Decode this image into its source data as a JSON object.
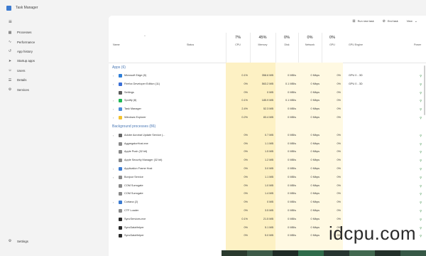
{
  "window": {
    "title": "Task Manager"
  },
  "nav": {
    "items": [
      {
        "label": "Processes",
        "icon": "grid-icon",
        "glyph": "▦"
      },
      {
        "label": "Performance",
        "icon": "chart-icon",
        "glyph": "∿"
      },
      {
        "label": "App history",
        "icon": "history-icon",
        "glyph": "↺"
      },
      {
        "label": "Startup apps",
        "icon": "startup-icon",
        "glyph": "➤"
      },
      {
        "label": "Users",
        "icon": "users-icon",
        "glyph": "☺"
      },
      {
        "label": "Details",
        "icon": "details-icon",
        "glyph": "☰"
      },
      {
        "label": "Services",
        "icon": "services-icon",
        "glyph": "⚙"
      }
    ],
    "settings": {
      "label": "Settings",
      "glyph": "⚙"
    }
  },
  "toolbar": {
    "run_task": "Run new task",
    "end_task": "End task",
    "view": "View"
  },
  "columns": {
    "name": "Name",
    "status": "Status",
    "cpu": {
      "pct": "7%",
      "label": "CPU"
    },
    "memory": {
      "pct": "45%",
      "label": "Memory"
    },
    "disk": {
      "pct": "0%",
      "label": "Disk"
    },
    "network": {
      "pct": "0%",
      "label": "Network"
    },
    "gpu": {
      "pct": "0%",
      "label": "GPU"
    },
    "gpu_engine": {
      "label": "GPU Engine"
    },
    "power": {
      "label": "Power"
    }
  },
  "colors": {
    "heat_light": "#fff9e2",
    "heat_mid": "#fdf1c4",
    "section_blue": "#4a78b5"
  },
  "apps": {
    "title": "Apps (6)",
    "rows": [
      {
        "name": "Microsoft Edge (8)",
        "color": "#2f7fd8",
        "cpu": "0.1%",
        "mem": "358.6 MB",
        "disk": "0 MB/s",
        "net": "0 Mbps",
        "gpu": "0%",
        "engine": "GPU 0 - 3D"
      },
      {
        "name": "Firefox Developer Edition (11)",
        "color": "#3a6fd6",
        "cpu": "0%",
        "mem": "563.2 MB",
        "disk": "0.1 MB/s",
        "net": "0 Mbps",
        "gpu": "0%",
        "engine": "GPU 0 - 3D"
      },
      {
        "name": "Settings",
        "color": "#5b5b5b",
        "cpu": "0%",
        "mem": "0 MB",
        "disk": "0 MB/s",
        "net": "0 Mbps",
        "gpu": "0%",
        "engine": ""
      },
      {
        "name": "Spotify (8)",
        "color": "#1db954",
        "cpu": "0.1%",
        "mem": "185.9 MB",
        "disk": "0.1 MB/s",
        "net": "0 Mbps",
        "gpu": "0%",
        "engine": ""
      },
      {
        "name": "Task Manager",
        "color": "#4c8bd8",
        "cpu": "2.4%",
        "mem": "52.3 MB",
        "disk": "0 MB/s",
        "net": "0 Mbps",
        "gpu": "0%",
        "engine": ""
      },
      {
        "name": "Windows Explorer",
        "color": "#f2c230",
        "cpu": "0.2%",
        "mem": "83.4 MB",
        "disk": "0 MB/s",
        "net": "0 Mbps",
        "gpu": "0%",
        "engine": ""
      }
    ]
  },
  "background": {
    "title": "Background processes (86)",
    "rows": [
      {
        "name": "Adobe Acrobat Update Service (...",
        "color": "#666666",
        "cpu": "0%",
        "mem": "0.7 MB",
        "disk": "0 MB/s",
        "net": "0 Mbps",
        "gpu": "0%"
      },
      {
        "name": "AggregatorHost.exe",
        "color": "#8a8a8a",
        "cpu": "0%",
        "mem": "1.1 MB",
        "disk": "0 MB/s",
        "net": "0 Mbps",
        "gpu": "0%"
      },
      {
        "name": "Apple Push (32 bit)",
        "color": "#8a8a8a",
        "cpu": "0%",
        "mem": "1.5 MB",
        "disk": "0 MB/s",
        "net": "0 Mbps",
        "gpu": "0%"
      },
      {
        "name": "Apple Security Manager (32 bit)",
        "color": "#8a8a8a",
        "cpu": "0%",
        "mem": "1.2 MB",
        "disk": "0 MB/s",
        "net": "0 Mbps",
        "gpu": "0%"
      },
      {
        "name": "Application Frame Host",
        "color": "#3c7bd0",
        "cpu": "0%",
        "mem": "3.0 MB",
        "disk": "0 MB/s",
        "net": "0 Mbps",
        "gpu": "0%"
      },
      {
        "name": "Bonjour Service",
        "color": "#8a8a8a",
        "cpu": "0%",
        "mem": "1.1 MB",
        "disk": "0 MB/s",
        "net": "0 Mbps",
        "gpu": "0%"
      },
      {
        "name": "COM Surrogate",
        "color": "#8a8a8a",
        "cpu": "0%",
        "mem": "1.0 MB",
        "disk": "0 MB/s",
        "net": "0 Mbps",
        "gpu": "0%"
      },
      {
        "name": "COM Surrogate",
        "color": "#8a8a8a",
        "cpu": "0%",
        "mem": "1.4 MB",
        "disk": "0 MB/s",
        "net": "0 Mbps",
        "gpu": "0%"
      },
      {
        "name": "Cortana (2)",
        "color": "#3c7bd0",
        "cpu": "0%",
        "mem": "0 MB",
        "disk": "0 MB/s",
        "net": "0 Mbps",
        "gpu": "0%"
      },
      {
        "name": "CTF Loader",
        "color": "#8a8a8a",
        "cpu": "0%",
        "mem": "3.5 MB",
        "disk": "0 MB/s",
        "net": "0 Mbps",
        "gpu": "0%"
      },
      {
        "name": "SyncServices.exe",
        "color": "#2b2b2b",
        "cpu": "0.1%",
        "mem": "21.5 MB",
        "disk": "0 MB/s",
        "net": "0 Mbps",
        "gpu": "0%"
      },
      {
        "name": "SyncDataHelper",
        "color": "#2b2b2b",
        "cpu": "0%",
        "mem": "5.1 MB",
        "disk": "0 MB/s",
        "net": "0 Mbps",
        "gpu": "0%"
      },
      {
        "name": "SyncDataHelper",
        "color": "#2b2b2b",
        "cpu": "0%",
        "mem": "5.0 MB",
        "disk": "0 MB/s",
        "net": "0 Mbps",
        "gpu": "0%"
      }
    ]
  },
  "watermark": "idcpu.com"
}
